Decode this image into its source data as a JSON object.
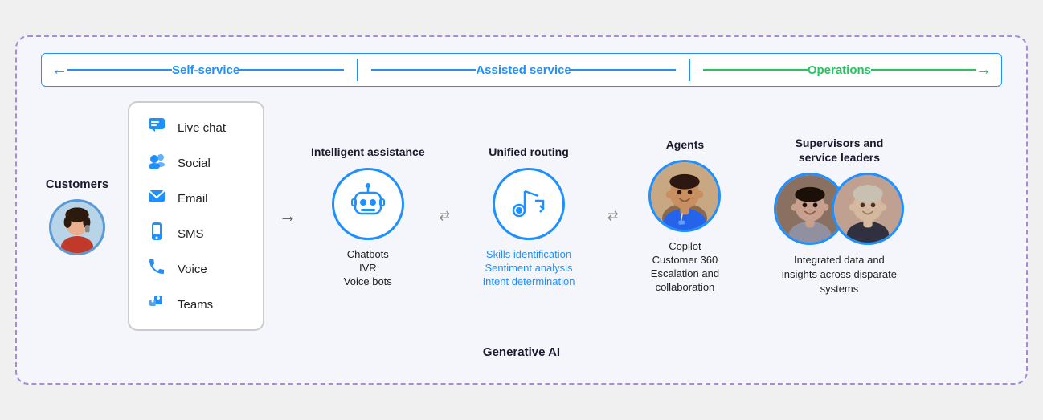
{
  "diagram": {
    "border_color": "#a78bda",
    "top_bar": {
      "self_service_label": "Self-service",
      "assisted_service_label": "Assisted service",
      "operations_label": "Operations"
    },
    "customers": {
      "label": "Customers"
    },
    "channels": {
      "items": [
        {
          "id": "live-chat",
          "label": "Live chat",
          "icon": "chat"
        },
        {
          "id": "social",
          "label": "Social",
          "icon": "social"
        },
        {
          "id": "email",
          "label": "Email",
          "icon": "email"
        },
        {
          "id": "sms",
          "label": "SMS",
          "icon": "sms"
        },
        {
          "id": "voice",
          "label": "Voice",
          "icon": "voice"
        },
        {
          "id": "teams",
          "label": "Teams",
          "icon": "teams"
        }
      ]
    },
    "intelligent_assistance": {
      "title": "Intelligent assistance",
      "labels": [
        {
          "text": "Chatbots",
          "color": "black"
        },
        {
          "text": "IVR",
          "color": "black"
        },
        {
          "text": "Voice bots",
          "color": "black"
        }
      ]
    },
    "unified_routing": {
      "title": "Unified routing",
      "labels": [
        {
          "text": "Skills identification",
          "color": "blue"
        },
        {
          "text": "Sentiment analysis",
          "color": "blue"
        },
        {
          "text": "Intent determination",
          "color": "blue"
        }
      ]
    },
    "agents": {
      "title": "Agents",
      "labels": [
        {
          "text": "Copilot",
          "color": "black"
        },
        {
          "text": "Customer 360",
          "color": "black"
        },
        {
          "text": "Escalation and collaboration",
          "color": "black"
        }
      ]
    },
    "supervisors": {
      "title": "Supervisors and service leaders",
      "labels": [
        {
          "text": "Integrated data and insights across disparate systems",
          "color": "black"
        }
      ]
    },
    "bottom_label": "Generative AI"
  }
}
